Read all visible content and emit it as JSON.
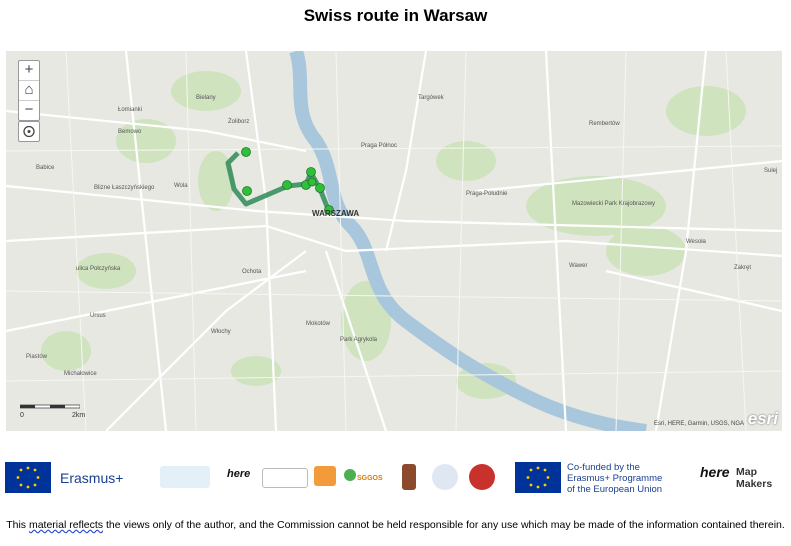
{
  "title": "Swiss route in Warsaw",
  "map": {
    "zoom_in": "+",
    "home": "⌂",
    "zoom_out": "−",
    "locate": "◎",
    "scale_labels": [
      "0",
      "2km"
    ],
    "attribution": "Esri, HERE, Garmin, USGS, NGA",
    "esri_logo": "esri",
    "labels": {
      "city": "WARSZAWA",
      "bielany": "Bielany",
      "zoliborz": "Żoliborz",
      "praga_polnoc": "Praga Północ",
      "praga_poludnie": "Praga-Południe",
      "targowek": "Targówek",
      "bemowo": "Bemowo",
      "wola": "Wola",
      "ochota": "Ochota",
      "mokotow": "Mokotów",
      "ursus": "Ursus",
      "wlochy": "Włochy",
      "wawer": "Wawer",
      "rembertow": "Rembertów",
      "zakret": "Zakręt",
      "wesola": "Wesoła",
      "michalowice": "Michałowice",
      "piastow": "Piastów",
      "babice": "Babice",
      "bledy": "Blizne Łaszczyńskiego",
      "ulica_polczynska": "ulica Połczyńska",
      "lomianki": "Łomianki",
      "mazowiecki": "Mazowiecki Park Krajobrazowy",
      "park_agrykola": "Park Agrykola",
      "sulejowek": "Sulej"
    },
    "route_color": "#2e8b57",
    "stop_color": "#2fbf3a",
    "stop_count": 8
  },
  "logos": {
    "erasmus": "Erasmus+",
    "cofunded": [
      "Co-funded by the",
      "Erasmus+ Programme",
      "of the European Union"
    ],
    "mapmakers": [
      "Map",
      "Makers"
    ],
    "here": "here",
    "sggos": "SGGOS"
  },
  "footer": {
    "part1": "This ",
    "part2": "material reflects",
    "part3": " the views only of the author, and the Commission cannot be held responsible for any use which may be made of the information contained therein."
  }
}
